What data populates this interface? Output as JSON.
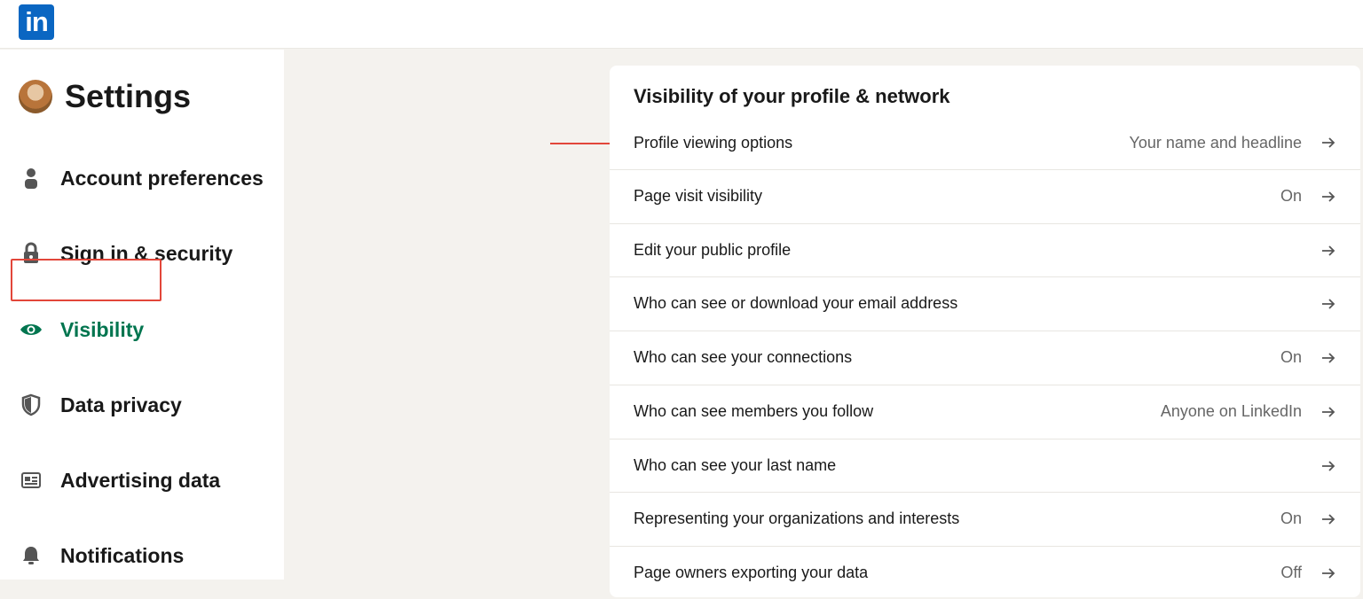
{
  "app": {
    "logo_text": "in",
    "brand_color": "#0a66c2",
    "accent_color": "#01754f"
  },
  "sidebar": {
    "title": "Settings",
    "items": [
      {
        "label": "Account preferences",
        "icon": "person-icon",
        "active": false
      },
      {
        "label": "Sign in & security",
        "icon": "lock-icon",
        "active": false
      },
      {
        "label": "Visibility",
        "icon": "eye-icon",
        "active": true
      },
      {
        "label": "Data privacy",
        "icon": "shield-icon",
        "active": false
      },
      {
        "label": "Advertising data",
        "icon": "newspaper-icon",
        "active": false
      },
      {
        "label": "Notifications",
        "icon": "bell-icon",
        "active": false
      }
    ]
  },
  "main": {
    "section_title": "Visibility of your profile & network",
    "rows": [
      {
        "label": "Profile viewing options",
        "value": "Your name and headline"
      },
      {
        "label": "Page visit visibility",
        "value": "On"
      },
      {
        "label": "Edit your public profile",
        "value": ""
      },
      {
        "label": "Who can see or download your email address",
        "value": ""
      },
      {
        "label": "Who can see your connections",
        "value": "On"
      },
      {
        "label": "Who can see members you follow",
        "value": "Anyone on LinkedIn"
      },
      {
        "label": "Who can see your last name",
        "value": ""
      },
      {
        "label": "Representing your organizations and interests",
        "value": "On"
      },
      {
        "label": "Page owners exporting your data",
        "value": "Off"
      }
    ]
  },
  "annotations": {
    "highlight_color": "#e2463a"
  }
}
